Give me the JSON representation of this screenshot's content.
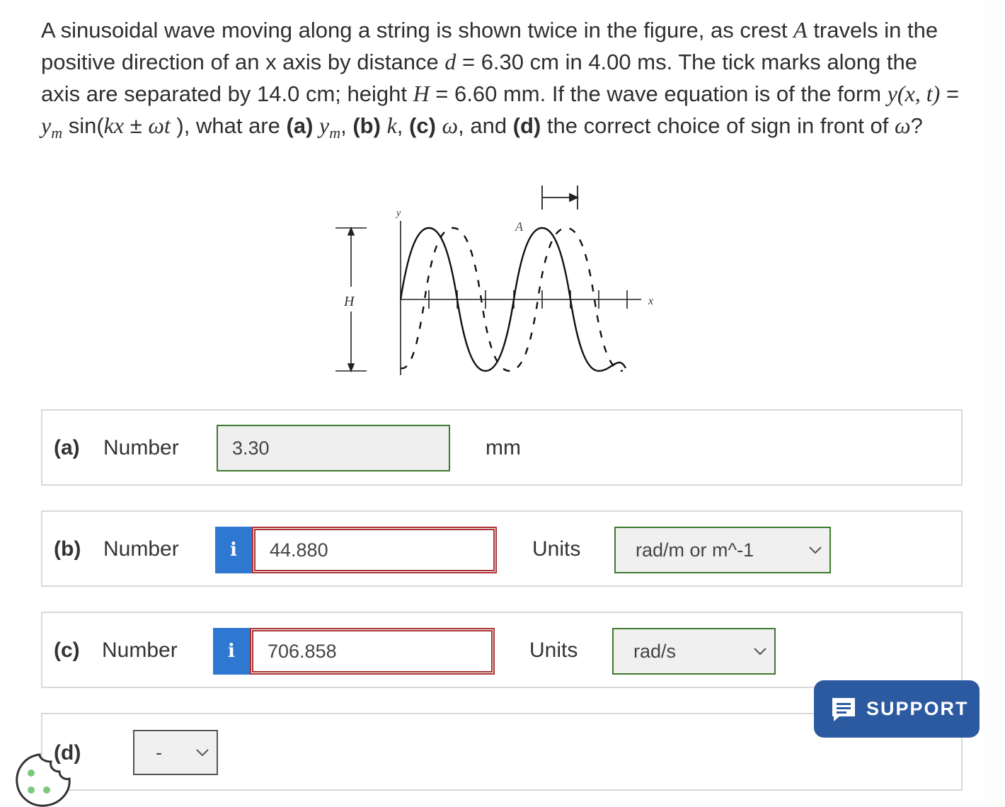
{
  "question": {
    "p1": "A sinusoidal wave moving along a string is shown twice in the figure, as crest ",
    "crest": "A",
    "p2": " travels in the positive direction of an x axis by distance ",
    "d_var": "d",
    "p3": " = 6.30 cm in 4.00 ms. The tick marks along the axis are separated by 14.0 cm; height ",
    "h_var": "H",
    "p4": " = 6.60 mm. If the wave equation is of the form ",
    "form": "y(x, t)",
    "p5": " = ",
    "ym": "y",
    "ym_sub": "m",
    "p6": " sin(",
    "kx": "kx",
    "pm": " ± ",
    "wt": "ωt",
    "p7": " ), what are ",
    "qa": "(a)",
    "p8": " ",
    "ym2": "y",
    "ym2_sub": "m",
    "p9": ", ",
    "qb": "(b)",
    "p10": " ",
    "k": "k",
    "p11": ", ",
    "qc": "(c)",
    "p12": " ",
    "w": "ω",
    "p13": ", and ",
    "qd": "(d)",
    "p14": " the correct choice of sign in front of ",
    "w2": "ω",
    "p15": "?"
  },
  "figure": {
    "y_label": "y",
    "x_label": "x",
    "a_label": "A",
    "h_label": "H"
  },
  "rows": {
    "a": {
      "part": "(a)",
      "label": "Number",
      "value": "3.30",
      "unit": "mm"
    },
    "b": {
      "part": "(b)",
      "label": "Number",
      "info": "i",
      "value": "44.880",
      "units_label": "Units",
      "units_value": "rad/m or m^-1"
    },
    "c": {
      "part": "(c)",
      "label": "Number",
      "info": "i",
      "value": "706.858",
      "units_label": "Units",
      "units_value": "rad/s"
    },
    "d": {
      "part": "(d)",
      "select_value": "-"
    }
  },
  "support": {
    "label": "SUPPORT"
  },
  "colors": {
    "correct_border": "#3e7a2c",
    "wrong_border": "#a33333",
    "info_blue": "#2f78d1",
    "support_blue": "#2c5aa0"
  }
}
